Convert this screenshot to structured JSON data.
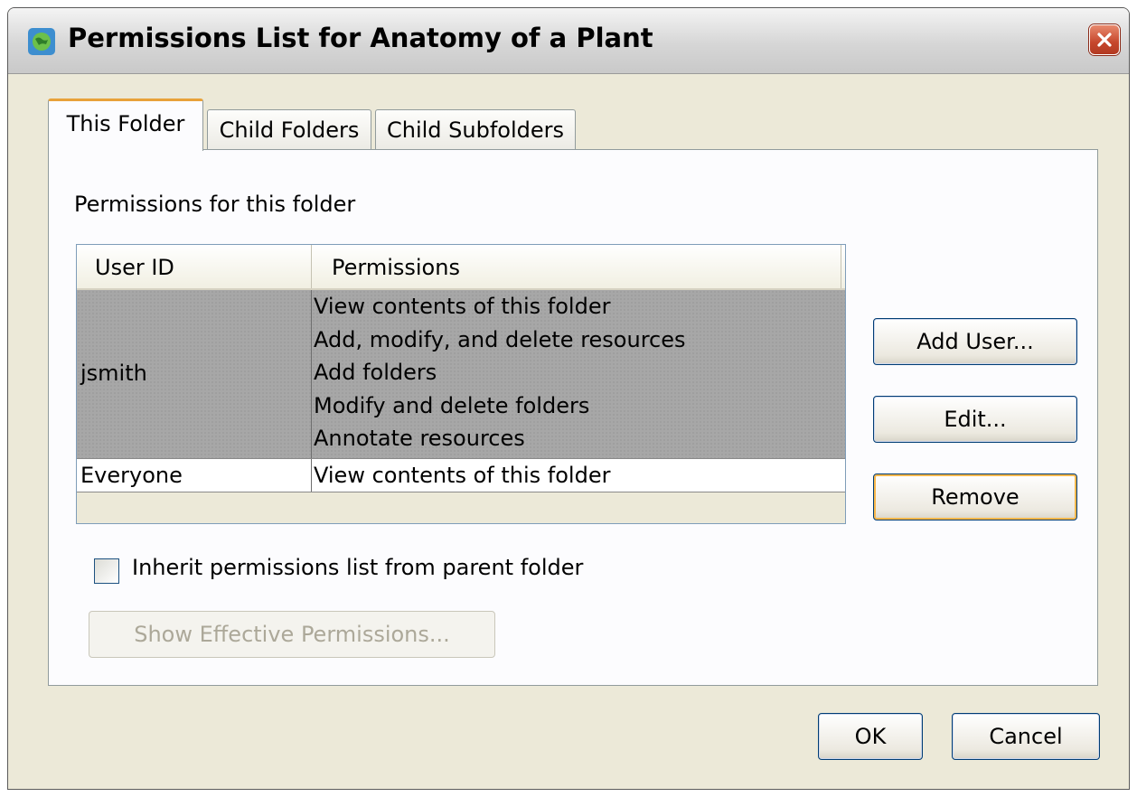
{
  "window": {
    "title": "Permissions List for Anatomy of a Plant"
  },
  "tabs": [
    {
      "label": "This Folder",
      "active": true
    },
    {
      "label": "Child Folders",
      "active": false
    },
    {
      "label": "Child Subfolders",
      "active": false
    }
  ],
  "panel": {
    "section_label": "Permissions for this folder",
    "table": {
      "columns": [
        "User ID",
        "Permissions"
      ],
      "rows": [
        {
          "user": "jsmith",
          "permissions": [
            "View contents of this folder",
            "Add, modify, and delete resources",
            "Add folders",
            "Modify and delete folders",
            "Annotate resources"
          ],
          "selected": true
        },
        {
          "user": "Everyone",
          "permissions": [
            "View contents of this folder"
          ],
          "selected": false
        }
      ]
    },
    "buttons": {
      "add_user": "Add User...",
      "edit": "Edit...",
      "remove": "Remove"
    },
    "inherit_checkbox": {
      "label": "Inherit permissions list from parent folder",
      "checked": false
    },
    "show_effective": "Show Effective Permissions..."
  },
  "footer": {
    "ok": "OK",
    "cancel": "Cancel"
  },
  "colors": {
    "active_tab_accent": "#e8a23a",
    "selected_row": "#a7a7a7",
    "close_button": "#c6462c"
  },
  "icons": {
    "app": "globe-icon",
    "close": "close-icon",
    "checkbox": "checkbox-icon"
  }
}
